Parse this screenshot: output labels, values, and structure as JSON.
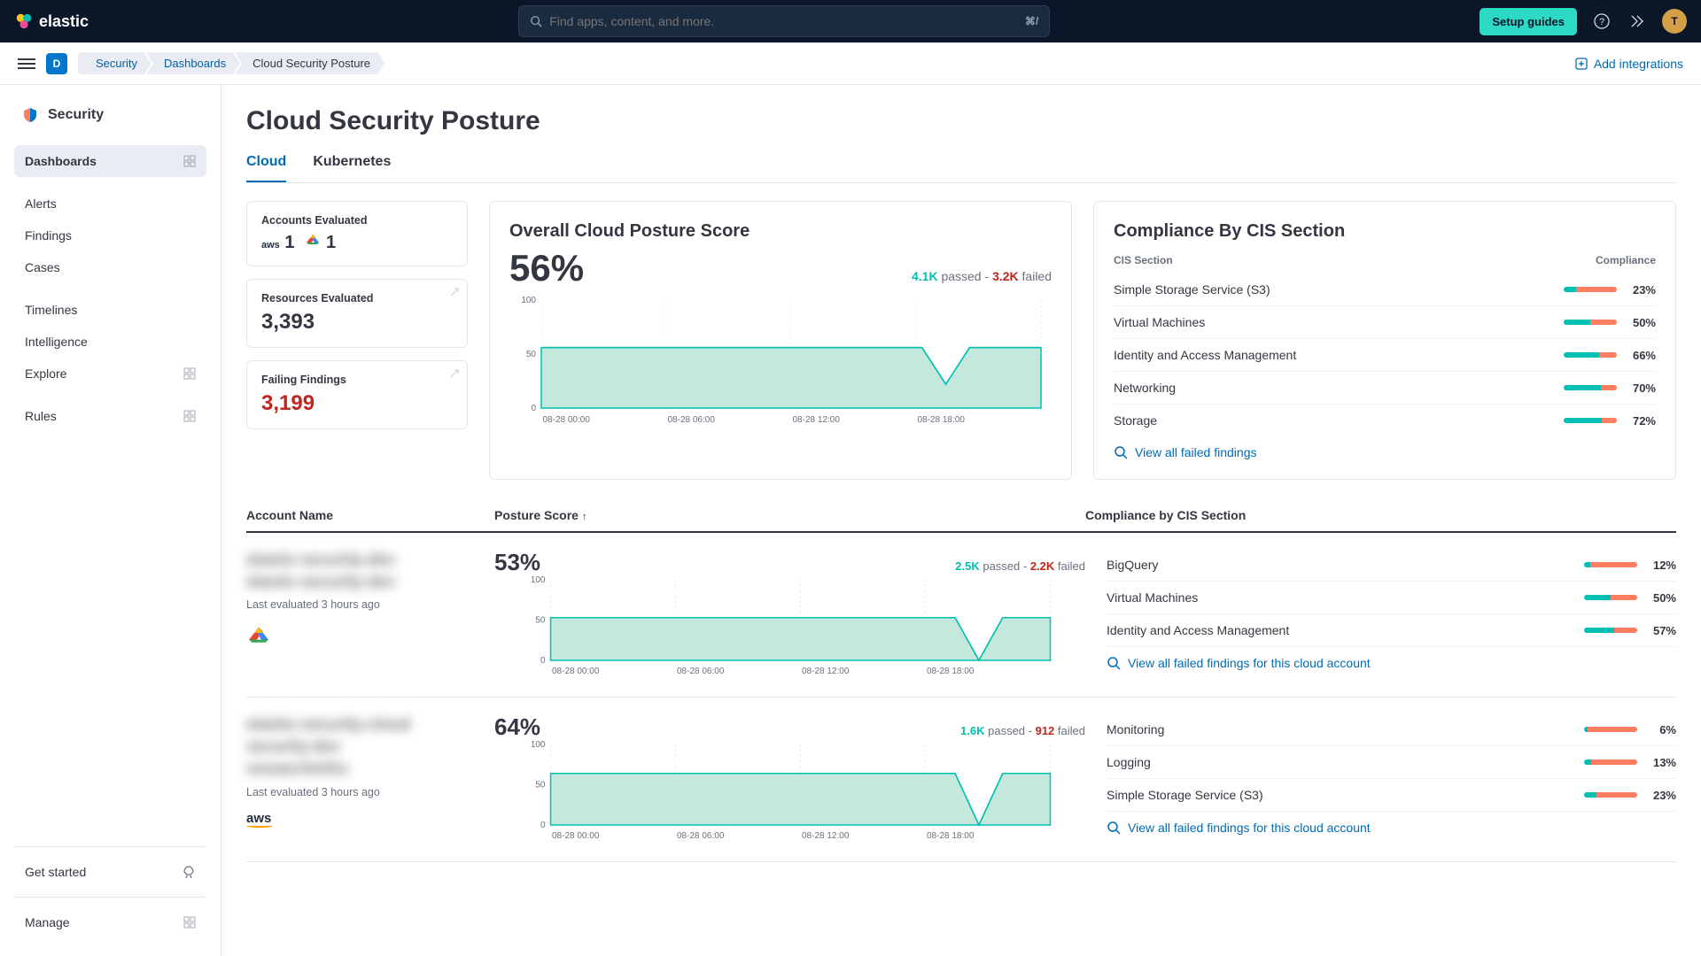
{
  "header": {
    "brand": "elastic",
    "search_placeholder": "Find apps, content, and more.",
    "kbd": "⌘/",
    "setup_guides": "Setup guides",
    "avatar_initial": "T",
    "space_initial": "D"
  },
  "breadcrumbs": [
    "Security",
    "Dashboards",
    "Cloud Security Posture"
  ],
  "add_integrations": "Add integrations",
  "sidebar": {
    "title": "Security",
    "items": [
      "Dashboards",
      "Alerts",
      "Findings",
      "Cases",
      "Timelines",
      "Intelligence",
      "Explore",
      "Rules"
    ],
    "get_started": "Get started",
    "manage": "Manage"
  },
  "page_title": "Cloud Security Posture",
  "tabs": [
    "Cloud",
    "Kubernetes"
  ],
  "cards": {
    "accounts_label": "Accounts Evaluated",
    "aws_count": "1",
    "gcp_count": "1",
    "resources_label": "Resources Evaluated",
    "resources_value": "3,393",
    "failing_label": "Failing Findings",
    "failing_value": "3,199"
  },
  "overall": {
    "title": "Overall Cloud Posture Score",
    "score": "56%",
    "passed": "4.1K",
    "passed_label": "passed",
    "sep": "-",
    "failed": "3.2K",
    "failed_label": "failed"
  },
  "compliance": {
    "title": "Compliance By CIS Section",
    "col1": "CIS Section",
    "col2": "Compliance",
    "rows": [
      {
        "name": "Simple Storage Service (S3)",
        "pct": 23
      },
      {
        "name": "Virtual Machines",
        "pct": 50
      },
      {
        "name": "Identity and Access Management",
        "pct": 66
      },
      {
        "name": "Networking",
        "pct": 70
      },
      {
        "name": "Storage",
        "pct": 72
      }
    ],
    "view_all": "View all failed findings"
  },
  "acct_headers": {
    "name": "Account Name",
    "score": "Posture Score",
    "comp": "Compliance by CIS Section"
  },
  "accounts": [
    {
      "name_blur": "elastic-security-dev\nelastic-security-dev",
      "last_eval": "Last evaluated 3 hours ago",
      "provider": "gcp",
      "score": "53%",
      "passed": "2.5K",
      "failed": "2.2K",
      "comp": [
        {
          "name": "BigQuery",
          "pct": 12
        },
        {
          "name": "Virtual Machines",
          "pct": 50
        },
        {
          "name": "Identity and Access Management",
          "pct": 57
        }
      ],
      "view_all": "View all failed findings for this cloud account"
    },
    {
      "name_blur": "elastic-security-cloud\nsecurity-dev\nresearchinfra",
      "last_eval": "Last evaluated 3 hours ago",
      "provider": "aws",
      "score": "64%",
      "passed": "1.6K",
      "failed": "912",
      "comp": [
        {
          "name": "Monitoring",
          "pct": 6
        },
        {
          "name": "Logging",
          "pct": 13
        },
        {
          "name": "Simple Storage Service (S3)",
          "pct": 23
        }
      ],
      "view_all": "View all failed findings for this cloud account"
    }
  ],
  "chart_data": {
    "type": "area",
    "xlabels": [
      "08-28 00:00",
      "08-28 06:00",
      "08-28 12:00",
      "08-28 18:00"
    ],
    "ylim": [
      0,
      100
    ],
    "yticks": [
      0,
      50,
      100
    ],
    "overall_series": [
      56,
      56,
      56,
      56,
      56,
      56,
      56,
      56,
      56,
      56,
      56,
      56,
      56,
      56,
      56,
      56,
      56,
      22,
      56,
      56,
      56,
      56
    ],
    "account_series": [
      [
        53,
        53,
        53,
        53,
        53,
        53,
        53,
        53,
        53,
        53,
        53,
        53,
        53,
        53,
        53,
        53,
        53,
        53,
        0,
        53,
        53,
        53
      ],
      [
        64,
        64,
        64,
        64,
        64,
        64,
        64,
        64,
        64,
        64,
        64,
        64,
        64,
        64,
        64,
        64,
        64,
        64,
        0,
        64,
        64,
        64
      ]
    ]
  },
  "labels": {
    "passed": "passed",
    "failed": "failed"
  }
}
